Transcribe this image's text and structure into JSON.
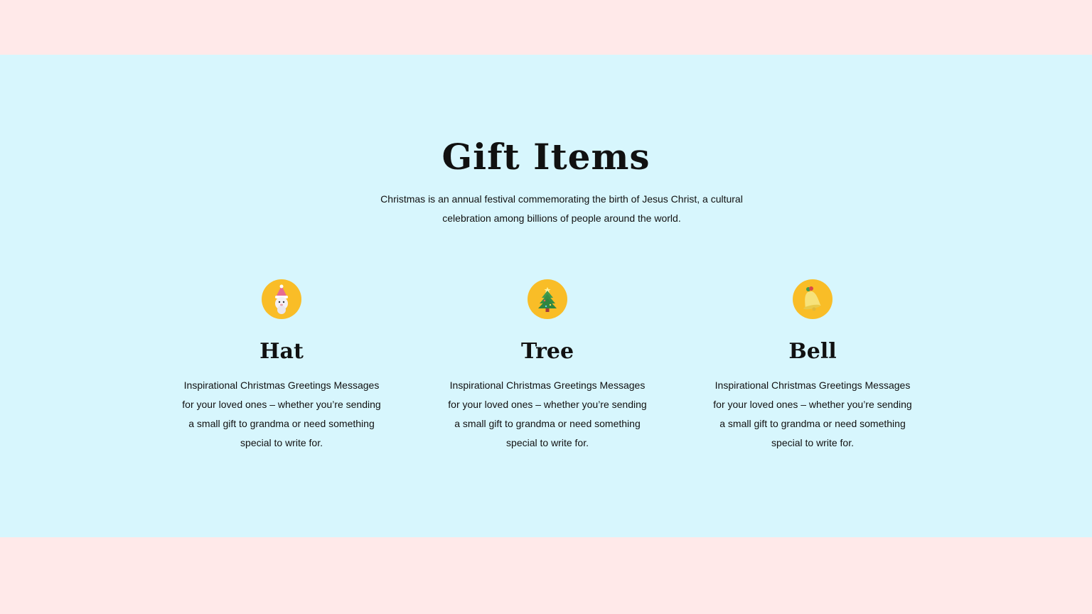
{
  "section": {
    "title": "Gift Items",
    "intro": "Christmas is an annual festival commemorating the birth of Jesus Christ, a cultural celebration among billions of people around the world."
  },
  "cards": [
    {
      "icon": "santa-snowman-icon",
      "title": "Hat",
      "text": "Inspirational Christmas Greetings Messages for your loved ones – whether you’re sending a small gift to grandma or need something special to write for."
    },
    {
      "icon": "christmas-tree-icon",
      "title": "Tree",
      "text": "Inspirational Christmas Greetings Messages for your loved ones – whether you’re sending a small gift to grandma or need something special to write for."
    },
    {
      "icon": "bell-icon",
      "title": "Bell",
      "text": "Inspirational Christmas Greetings Messages for your loved ones – whether you’re sending a small gift to grandma or need something special to write for."
    }
  ],
  "colors": {
    "page_background": "#ffe9e9",
    "section_background": "#d7f6fd",
    "icon_circle": "#f9bd27",
    "text": "#111111"
  }
}
